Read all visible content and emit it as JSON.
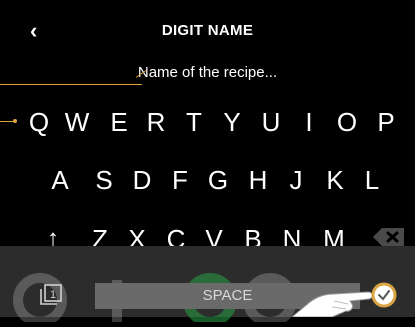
{
  "header": {
    "back_icon": "chevron-left-icon",
    "title": "DIGIT NAME"
  },
  "input": {
    "placeholder": "Name of the recipe..."
  },
  "keyboard": {
    "row1": [
      "Q",
      "W",
      "E",
      "R",
      "T",
      "Y",
      "U",
      "I",
      "O",
      "P"
    ],
    "row2": [
      "A",
      "S",
      "D",
      "F",
      "G",
      "H",
      "J",
      "K",
      "L"
    ],
    "row3": [
      "↑",
      "Z",
      "X",
      "C",
      "V",
      "B",
      "N",
      "M"
    ],
    "space_label": "SPACE",
    "backspace_icon": "backspace-icon",
    "pages_icon": "pages-icon",
    "pages_number": "1",
    "confirm_icon": "confirm-icon"
  },
  "colors": {
    "accent": "#d9a441",
    "background": "#000000",
    "key_text": "#ffffff",
    "space_bar": "#6a6a6a"
  }
}
